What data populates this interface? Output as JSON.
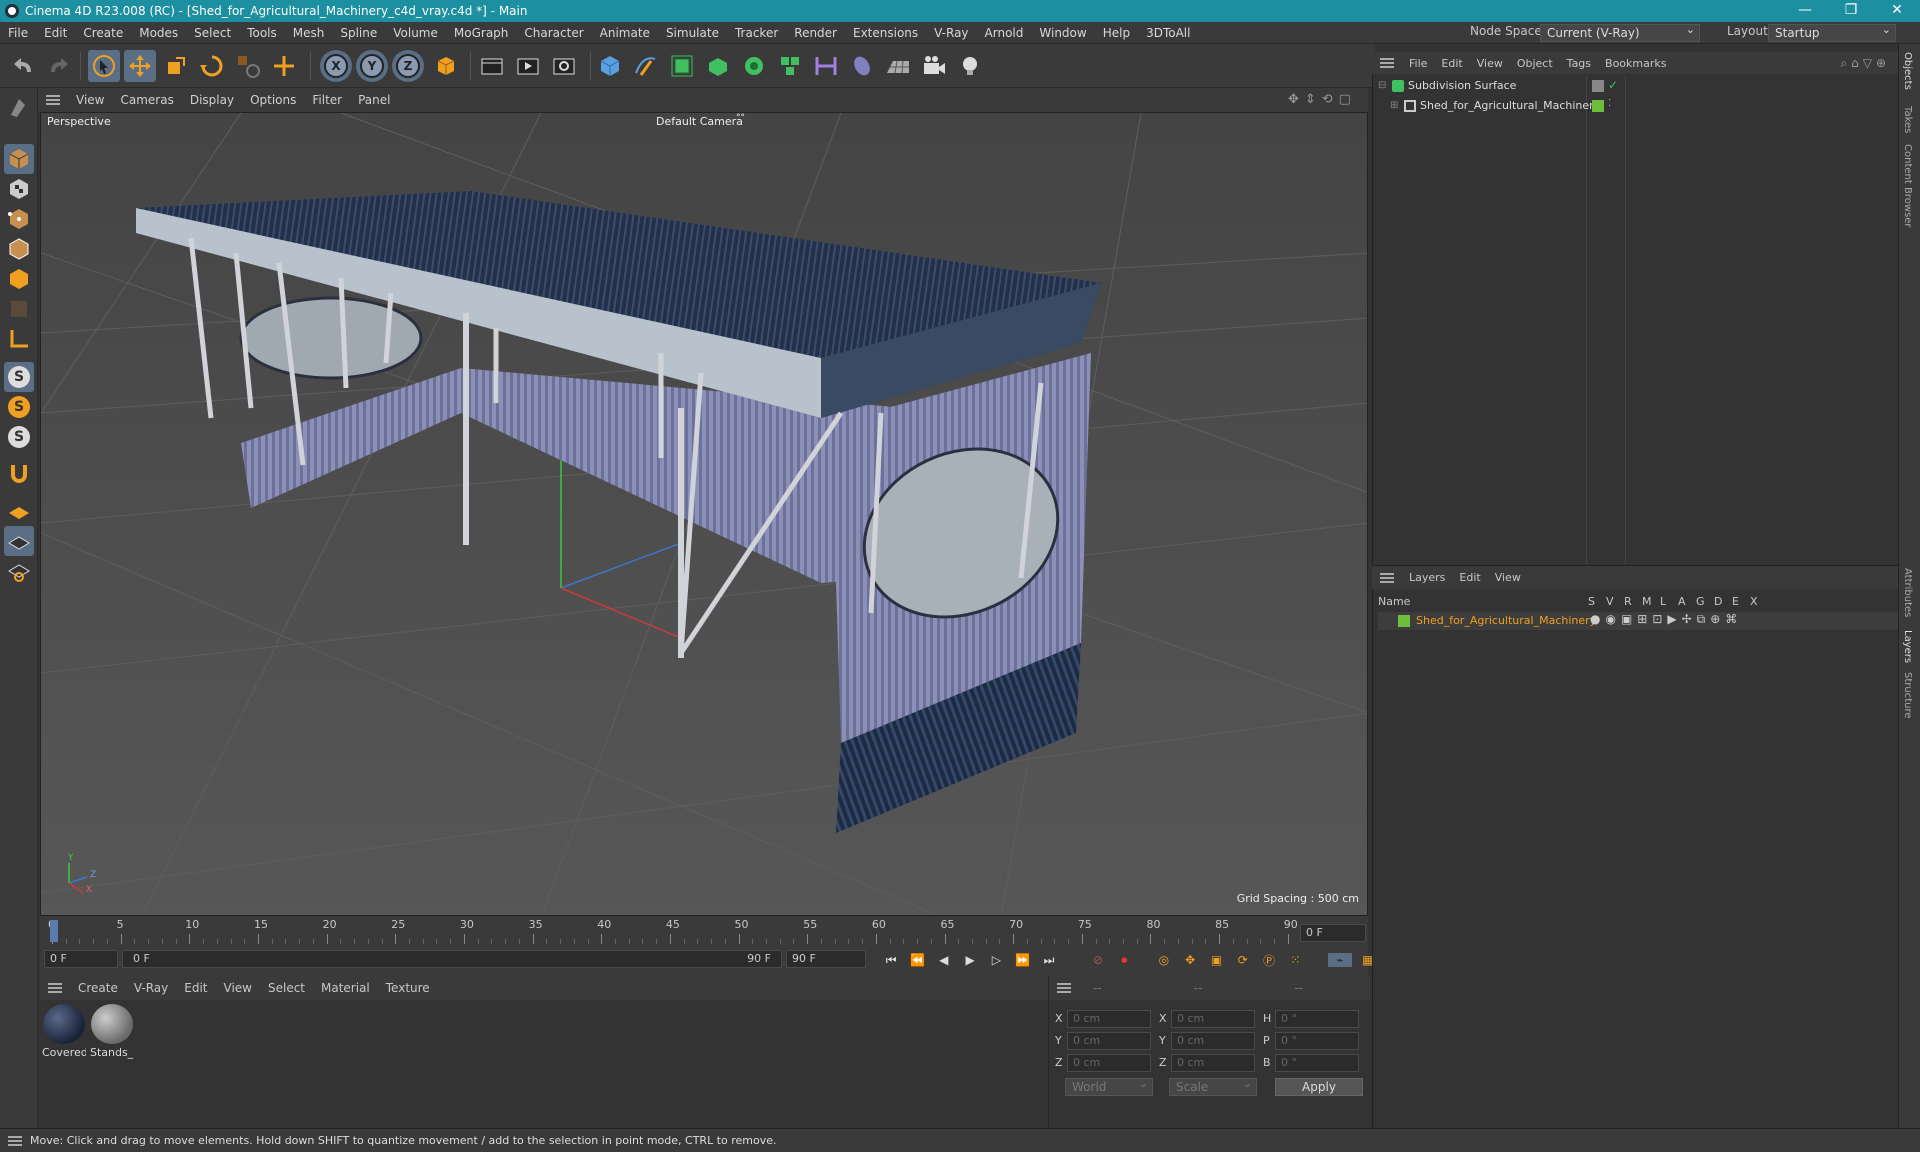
{
  "window": {
    "title": "Cinema 4D R23.008 (RC) - [Shed_for_Agricultural_Machinery_c4d_vray.c4d *] - Main",
    "controls": [
      "—",
      "❐",
      "✕"
    ]
  },
  "menu": {
    "items": [
      "File",
      "Edit",
      "Create",
      "Modes",
      "Select",
      "Tools",
      "Mesh",
      "Spline",
      "Volume",
      "MoGraph",
      "Character",
      "Animate",
      "Simulate",
      "Tracker",
      "Render",
      "Extensions",
      "V-Ray",
      "Arnold",
      "Window",
      "Help",
      "3DToAll"
    ],
    "node_space_label": "Node Space:",
    "node_space_value": "Current (V-Ray)",
    "layout_label": "Layout:",
    "layout_value": "Startup"
  },
  "toolbar": {
    "axis_labels": [
      "X",
      "Y",
      "Z"
    ]
  },
  "left_tools": {
    "s_labels": [
      "S",
      "S",
      "S"
    ]
  },
  "viewport": {
    "menu": [
      "View",
      "Cameras",
      "Display",
      "Options",
      "Filter",
      "Panel"
    ],
    "projection": "Perspective",
    "camera": "Default Camera",
    "camera_suffix": "°°",
    "grid_spacing": "Grid Spacing : 500 cm",
    "axis_y": "Y",
    "axis_z": "Z",
    "axis_x": "X"
  },
  "timeline": {
    "ticks": [
      "0",
      "5",
      "10",
      "15",
      "20",
      "25",
      "30",
      "35",
      "40",
      "45",
      "50",
      "55",
      "60",
      "65",
      "70",
      "75",
      "80",
      "85",
      "90"
    ],
    "current_frame": "0 F"
  },
  "transport": {
    "start": "0 F",
    "range_start": "0 F",
    "range_end": "90 F",
    "end": "90 F"
  },
  "materials": {
    "menu": [
      "Create",
      "V-Ray",
      "Edit",
      "View",
      "Select",
      "Material",
      "Texture"
    ],
    "items": [
      "Covered",
      "Stands_N"
    ]
  },
  "coords": {
    "header": [
      "--",
      "--",
      "--"
    ],
    "rows": [
      {
        "a": "X",
        "av": "0 cm",
        "b": "X",
        "bv": "0 cm",
        "c": "H",
        "cv": "0 °"
      },
      {
        "a": "Y",
        "av": "0 cm",
        "b": "Y",
        "bv": "0 cm",
        "c": "P",
        "cv": "0 °"
      },
      {
        "a": "Z",
        "av": "0 cm",
        "b": "Z",
        "bv": "0 cm",
        "c": "B",
        "cv": "0 °"
      }
    ],
    "world": "World",
    "scale": "Scale",
    "apply": "Apply"
  },
  "objects": {
    "menu": [
      "File",
      "Edit",
      "View",
      "Object",
      "Tags",
      "Bookmarks"
    ],
    "items": [
      {
        "name": "Subdivision Surface"
      },
      {
        "name": "Shed_for_Agricultural_Machinery"
      }
    ]
  },
  "layers": {
    "menu": [
      "Layers",
      "Edit",
      "View"
    ],
    "col_name": "Name",
    "cols": [
      "S",
      "V",
      "R",
      "M",
      "L",
      "A",
      "G",
      "D",
      "E",
      "X"
    ],
    "items": [
      {
        "name": "Shed_for_Agricultural_Machinery",
        "color": "#6cbf3a"
      }
    ]
  },
  "right_tabs": [
    "Objects",
    "Takes",
    "Content Browser",
    "Attributes",
    "Layers",
    "Structure"
  ],
  "status": "Move: Click and drag to move elements. Hold down SHIFT to quantize movement / add to the selection in point mode, CTRL to remove.",
  "colors": {
    "title_bar": "#1c8fa0",
    "accent_orange": "#f0a020",
    "selection_blue": "#5a6e86",
    "layer_green": "#6cbf3a",
    "layer_name_orange": "#f0a020"
  }
}
